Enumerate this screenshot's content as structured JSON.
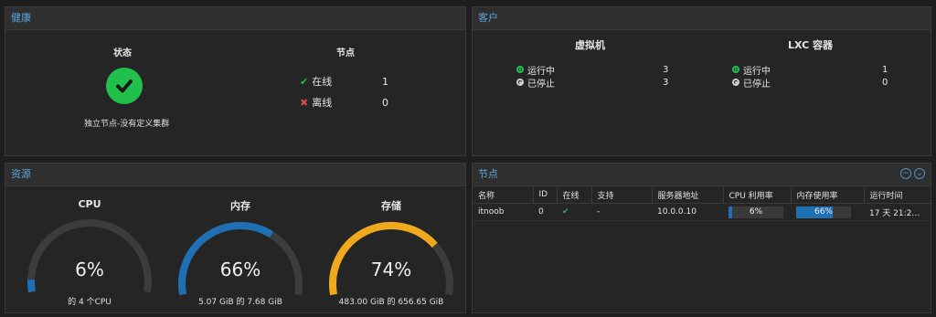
{
  "health": {
    "title": "健康",
    "status_heading": "状态",
    "status_text": "独立节点-没有定义集群",
    "nodes_heading": "节点",
    "online_label": "在线",
    "online_count": "1",
    "offline_label": "离线",
    "offline_count": "0",
    "status_color": "#21bf4b"
  },
  "guests": {
    "title": "客户",
    "vm": {
      "heading": "虚拟机",
      "running_label": "运行中",
      "running": "3",
      "stopped_label": "已停止",
      "stopped": "3"
    },
    "lxc": {
      "heading": "LXC 容器",
      "running_label": "运行中",
      "running": "1",
      "stopped_label": "已停止",
      "stopped": "0"
    }
  },
  "resources": {
    "title": "资源",
    "cpu": {
      "title": "CPU",
      "value": "6%",
      "percent": 6,
      "sub": "的 4 个CPU",
      "color": "#1f6fb5"
    },
    "memory": {
      "title": "内存",
      "value": "66%",
      "percent": 66,
      "sub": "5.07 GiB 的 7.68 GiB",
      "color": "#1f6fb5"
    },
    "storage": {
      "title": "存储",
      "value": "74%",
      "percent": 74,
      "sub": "483.00 GiB 的 656.65 GiB",
      "color": "#f0a81c"
    }
  },
  "nodes": {
    "title": "节点",
    "columns": [
      "名称",
      "ID",
      "在线",
      "支持",
      "服务器地址",
      "CPU 利用率",
      "内存使用率",
      "运行时间"
    ],
    "rows": [
      {
        "name": "itnoob",
        "id": "0",
        "online": "check-icon",
        "support": "-",
        "address": "10.0.0.10",
        "cpu": "6%",
        "cpu_pct": 6,
        "mem": "66%",
        "mem_pct": 66,
        "uptime": "17 天 21:2…"
      }
    ]
  }
}
